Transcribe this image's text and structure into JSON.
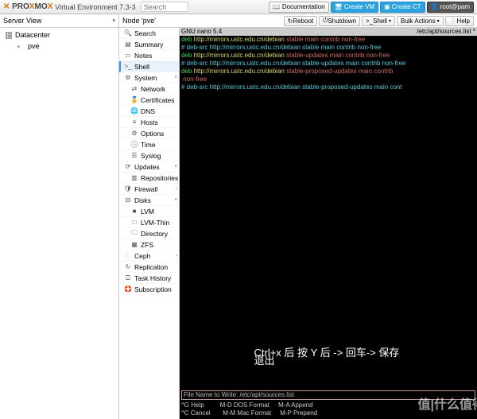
{
  "header": {
    "brand_pre": "PRO",
    "brand_mid": "MO",
    "ve_label": "Virtual Environment 7.3-3",
    "search_placeholder": "Search",
    "doc": "Documentation",
    "create_vm": "Create VM",
    "create_ct": "Create CT",
    "user": "root@pam"
  },
  "row2": {
    "server_view": "Server View",
    "node_title": "Node 'pve'",
    "reboot": "Reboot",
    "shutdown": "Shutdown",
    "shell": "Shell",
    "bulk": "Bulk Actions",
    "help": "Help"
  },
  "tree": {
    "datacenter": "Datacenter",
    "pve": "pve"
  },
  "menu": {
    "search": "Search",
    "summary": "Summary",
    "notes": "Notes",
    "shell": "Shell",
    "system": "System",
    "network": "Network",
    "certificates": "Certificates",
    "dns": "DNS",
    "hosts": "Hosts",
    "options": "Options",
    "time": "Time",
    "syslog": "Syslog",
    "updates": "Updates",
    "repositories": "Repositories",
    "firewall": "Firewall",
    "disks": "Disks",
    "lvm": "LVM",
    "lvmthin": "LVM-Thin",
    "directory": "Directory",
    "zfs": "ZFS",
    "ceph": "Ceph",
    "replication": "Replication",
    "taskhistory": "Task History",
    "subscription": "Subscription"
  },
  "terminal": {
    "nano_left": "  GNU nano 5.4",
    "nano_right": "/etc/apt/sources.list *",
    "l1a": "deb ",
    "l1b": "http://mirrors.ustc.edu.cn/debian",
    "l1c": " stable",
    "l1d": " main contrib non-free",
    "l2": "# deb-src http://mirrors.ustc.edu.cn/debian stable main contrib non-free",
    "l3a": "deb ",
    "l3b": "http://mirrors.ustc.edu.cn/debian",
    "l3c": " stable-updates",
    "l3d": " main contrib non-free",
    "l4": "# deb-src http://mirrors.ustc.edu.cn/debian stable-updates main contrib non-free",
    "l5a": "deb ",
    "l5b": "http://mirrors.ustc.edu.cn/debian",
    "l5c": " stable-proposed-updates",
    "l5d": " main contrib",
    "l5e": " non-free",
    "l6": "# deb-src http://mirrors.ustc.edu.cn/debian stable-proposed-updates main cont",
    "overlay": "Ctrl+x 后 按 Y  后 -> 回车-> 保存退出",
    "save_prompt": "File Name to Write: /etc/apt/sources.list",
    "help1": "^G Help         M-D DOS Format     M-A Append    ",
    "help2": "^C Cancel       M-M Mac Format     M-P Prepend   "
  },
  "watermark": {
    "main": "值|什么值得",
    "sub": ""
  }
}
